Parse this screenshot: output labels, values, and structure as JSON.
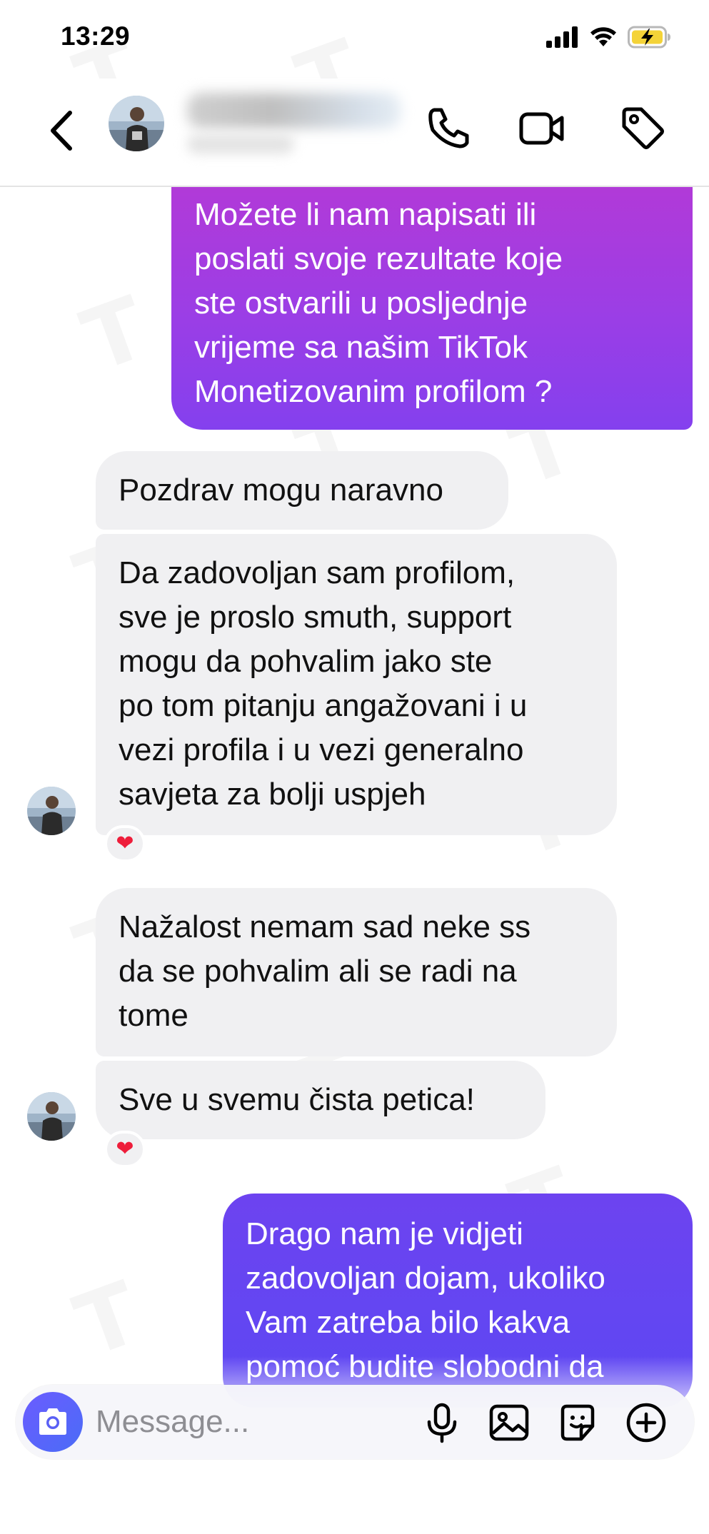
{
  "status_bar": {
    "time": "13:29",
    "icons": [
      "signal-icon",
      "wifi-icon",
      "battery-charging-icon"
    ]
  },
  "header": {
    "contact_name": "",
    "icons": [
      "back-icon",
      "avatar",
      "phone-icon",
      "video-camera-icon",
      "tag-icon"
    ]
  },
  "colors": {
    "outgoing_gradient_top": "#a83be2",
    "outgoing_gradient_mid": "#8a3ef0",
    "outgoing_gradient_bottom": "#5b45f5",
    "incoming_bubble": "#f0f0f2",
    "heart": "#ee1d3a",
    "camera_button": "#5a60f5"
  },
  "messages": [
    {
      "direction": "outgoing",
      "lines": [
        "Možete li nam napisati ili",
        "poslati svoje rezultate koje",
        "ste ostvarili u posljednje",
        "vrijeme sa našim TikTok",
        "Monetizovanim profilom ?"
      ]
    },
    {
      "direction": "incoming",
      "lines": [
        "Pozdrav mogu naravno"
      ]
    },
    {
      "direction": "incoming",
      "lines": [
        "Da zadovoljan sam profilom,",
        "sve je proslo smuth, support",
        "mogu da pohvalim jako ste",
        "po tom pitanju angažovani i u",
        "vezi profila i u vezi generalno",
        "savjeta za bolji uspjeh"
      ],
      "reaction": "❤"
    },
    {
      "direction": "incoming",
      "lines": [
        "Nažalost nemam sad neke ss",
        "da se pohvalim ali se radi na",
        "tome"
      ]
    },
    {
      "direction": "incoming",
      "lines": [
        "Sve u svemu čista petica!"
      ],
      "reaction": "❤"
    },
    {
      "direction": "outgoing",
      "lines": [
        "Drago nam je vidjeti",
        "zadovoljan dojam, ukoliko",
        "Vam zatreba bilo kakva",
        "pomoć budite slobodni da"
      ]
    }
  ],
  "composer": {
    "placeholder": "Message...",
    "icons": [
      "camera-icon",
      "microphone-icon",
      "gallery-icon",
      "sticker-icon",
      "plus-icon"
    ]
  }
}
